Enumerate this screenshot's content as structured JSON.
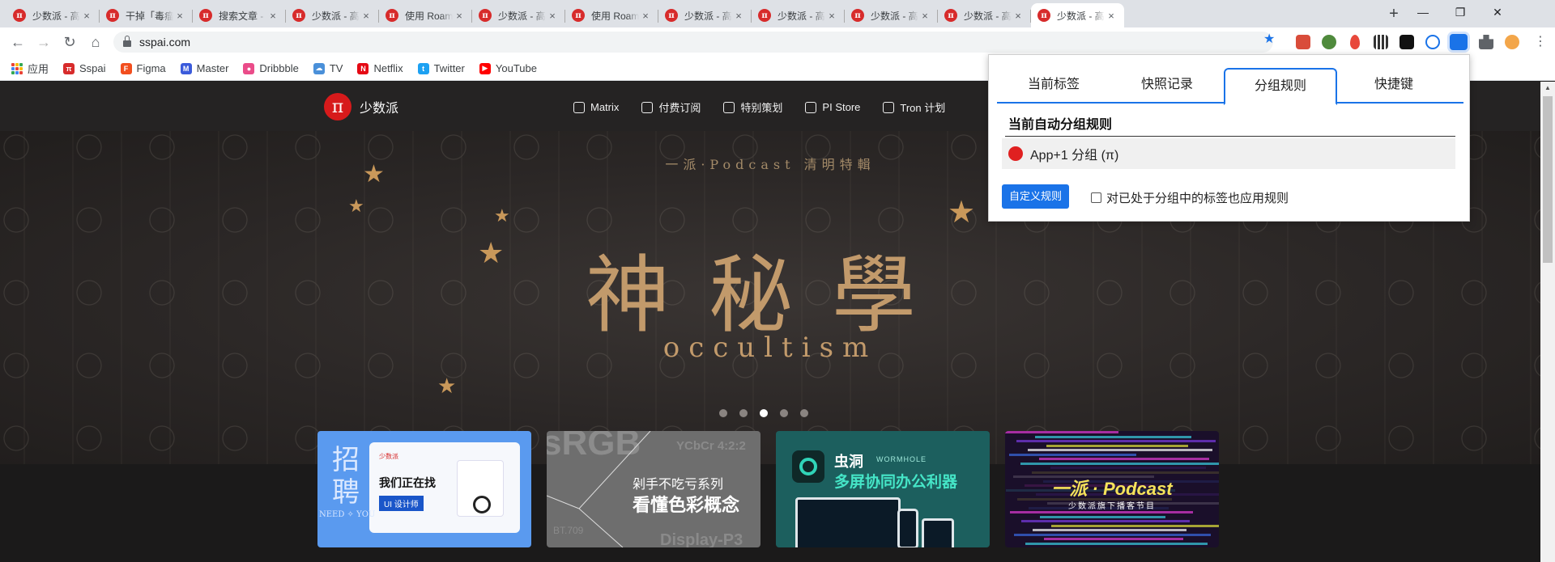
{
  "tabs": [
    {
      "title": "少数派 - 高效工作"
    },
    {
      "title": "干掉「毒瘤」软件"
    },
    {
      "title": "搜索文章 - 少数派"
    },
    {
      "title": "少数派 - 高效工作"
    },
    {
      "title": "使用 Roam Research"
    },
    {
      "title": "少数派 - 高效工作"
    },
    {
      "title": "使用 Roam Research"
    },
    {
      "title": "少数派 - 高效工作"
    },
    {
      "title": "少数派 - 高效工作"
    },
    {
      "title": "少数派 - 高效工作"
    },
    {
      "title": "少数派 - 高效工作"
    },
    {
      "title": "少数派 - 高效工作",
      "active": true
    }
  ],
  "favicon_glyph": "π",
  "new_tab_glyph": "+",
  "close_glyph": "×",
  "window_controls": {
    "minimize": "—",
    "restore": "❐",
    "close": "✕"
  },
  "nav": {
    "back": "←",
    "forward": "→",
    "reload": "↻",
    "home": "⌂"
  },
  "address": {
    "url": "sspai.com"
  },
  "bookmark_star": "★",
  "bookmarks": [
    {
      "label": "应用",
      "icon": "apps-grid-icon"
    },
    {
      "label": "Sspai",
      "icon": "sspai-icon",
      "color": "#d72b2b",
      "glyph": "π"
    },
    {
      "label": "Figma",
      "icon": "figma-icon",
      "color": "#f24e1e",
      "glyph": "F"
    },
    {
      "label": "Master",
      "icon": "master-icon",
      "color": "#3b5bdb",
      "glyph": "M"
    },
    {
      "label": "Dribbble",
      "icon": "dribbble-icon",
      "color": "#ea4c89",
      "glyph": "●"
    },
    {
      "label": "TV",
      "icon": "tv-icon",
      "color": "#4a90d9",
      "glyph": "☁"
    },
    {
      "label": "Netflix",
      "icon": "netflix-icon",
      "color": "#e50914",
      "glyph": "N"
    },
    {
      "label": "Twitter",
      "icon": "twitter-icon",
      "color": "#1da1f2",
      "glyph": "t"
    },
    {
      "label": "YouTube",
      "icon": "youtube-icon",
      "color": "#ff0000",
      "glyph": "▶"
    }
  ],
  "site": {
    "logo_glyph": "π",
    "logo_name": "少数派",
    "nav_links": [
      "Matrix",
      "付费订阅",
      "特别策划",
      "PI Store",
      "Tron 计划"
    ],
    "hero": {
      "subtitle": "一派·Podcast 清明特輯",
      "title": "神秘學",
      "english": "occultism",
      "star_glyph": "★",
      "active_dot": 2,
      "dot_count": 5
    },
    "cards": {
      "c1_big": "招聘",
      "c1_badge": "少数派",
      "c1_title": "我们正在找",
      "c1_role": "UI 设计师",
      "c1_need": "NEED ✧ YOU",
      "c2_srgb": "sRGB",
      "c2_ycbcr": "YCbCr 4:2:2",
      "c2_series": "剁手不吃亏系列",
      "c2_title": "看懂色彩概念",
      "c2_bt": "BT.709",
      "c2_display": "Display-P3",
      "c3_name": "虫洞",
      "c3_wormhole": "WORMHOLE",
      "c3_tagline": "多屏协同办公利器",
      "c4_title": "一派 · Podcast",
      "c4_sub": "少数派旗下播客节目"
    }
  },
  "popup": {
    "tabs": [
      "当前标签",
      "快照记录",
      "分组规则",
      "快捷键"
    ],
    "active_tab": 2,
    "section_title": "当前自动分组规则",
    "rule": "App+1 分组 (π)",
    "rule_color": "#e02020",
    "custom_button": "自定义规则",
    "apply_checkbox": "对已处于分组中的标签也应用规则",
    "apply_checked": false
  },
  "accent": "#1a73e8"
}
